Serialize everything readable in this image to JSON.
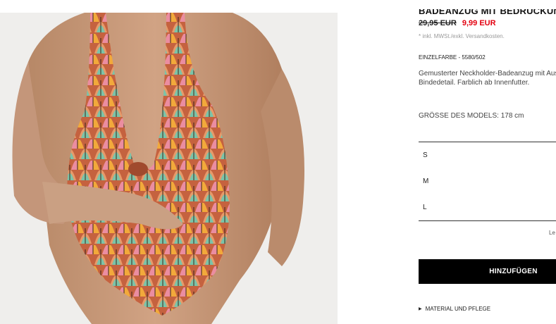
{
  "product": {
    "title": "BADEANZUG MIT BEDRUCKUNG",
    "price_old": "29,95 EUR",
    "price_new": "9,99 EUR",
    "tax_note": "* inkl. MWSt./exkl. Versandkosten.",
    "color_ref": "EINZELFARBE - 5580/502",
    "description": "Gemusterter Neckholder-Badeanzug mit Ausschnitt und Bindedetail. Farblich ab Innenfutter.",
    "model_size": "GRÖSSE DES MODELS: 178 cm"
  },
  "sizes": [
    "S",
    "M",
    "L"
  ],
  "size_guide": "Le",
  "add_button": "HINZUFÜGEN",
  "material_link": "MATERIAL UND PFLEGE",
  "colors": {
    "price_sale": "#e3000f",
    "button_bg": "#000000",
    "button_text": "#ffffff"
  }
}
